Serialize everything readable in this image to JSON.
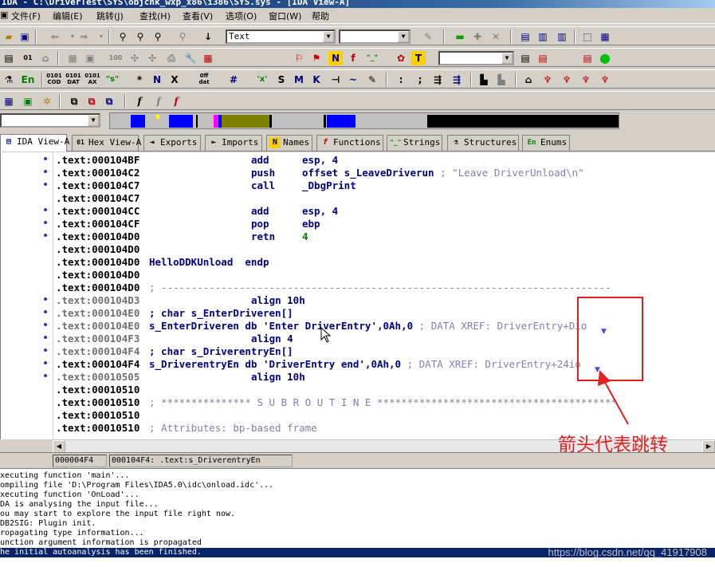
{
  "window": {
    "title": "IDA - C:\\DriverTest\\SYS\\objchk_wxp_x86\\i386\\SYS.sys - [IDA View-A]"
  },
  "menu": {
    "items": [
      "文件(F)",
      "编辑(E)",
      "跳转(J)",
      "查找(H)",
      "查看(V)",
      "选项(O)",
      "窗口(W)",
      "帮助"
    ]
  },
  "toolbar": {
    "text_combo_value": "Text",
    "row3_labels": {
      "en": "En",
      "cod": "0101\nCOD",
      "dat": "0101\nDAT",
      "ax": "0101\nAX",
      "s": "\"s\"",
      "star": "*",
      "n": "N",
      "x": "X",
      "off": "0ff\ndat",
      "hash": "#",
      "x2": "'x'",
      "S": "S",
      "M": "M",
      "K": "K",
      "colon": ":",
      "semicolon": ";"
    }
  },
  "tabs": [
    {
      "label": "IDA View-A",
      "icon": "ida-view-icon"
    },
    {
      "label": "Hex View-A",
      "icon": "hex-view-icon"
    },
    {
      "label": "Exports",
      "icon": "exports-icon"
    },
    {
      "label": "Imports",
      "icon": "imports-icon"
    },
    {
      "label": "Names",
      "icon": "names-icon"
    },
    {
      "label": "Functions",
      "icon": "functions-icon"
    },
    {
      "label": "Strings",
      "icon": "strings-icon"
    },
    {
      "label": "Structures",
      "icon": "structures-icon"
    },
    {
      "label": "Enums",
      "icon": "enums-icon"
    }
  ],
  "disasm": {
    "lines": [
      {
        "addr": ".text:000104BF",
        "label": "",
        "mnem": "add",
        "ops": "esp, 4",
        "cmt": ""
      },
      {
        "addr": ".text:000104C2",
        "label": "",
        "mnem": "push",
        "ops": "offset s_LeaveDriverun",
        "cmt": " ; \"Leave DriverUnload\\n\""
      },
      {
        "addr": ".text:000104C7",
        "label": "",
        "mnem": "call",
        "ops": "_DbgPrint",
        "cmt": ""
      },
      {
        "addr": ".text:000104C7",
        "label": "",
        "mnem": "",
        "ops": "",
        "cmt": ""
      },
      {
        "addr": ".text:000104CC",
        "label": "",
        "mnem": "add",
        "ops": "esp, 4",
        "cmt": ""
      },
      {
        "addr": ".text:000104CF",
        "label": "",
        "mnem": "pop",
        "ops": "ebp",
        "cmt": ""
      },
      {
        "addr": ".text:000104D0",
        "label": "",
        "mnem": "retn",
        "ops": "4",
        "cmt": ""
      },
      {
        "addr": ".text:000104D0",
        "label": "",
        "mnem": "",
        "ops": "",
        "cmt": ""
      },
      {
        "addr": ".text:000104D0",
        "label": "HelloDDKUnload  endp",
        "mnem": "",
        "ops": "",
        "cmt": ""
      },
      {
        "addr": ".text:000104D0",
        "label": "",
        "mnem": "",
        "ops": "",
        "cmt": ""
      },
      {
        "addr": ".text:000104D0",
        "label": "",
        "mnem": "",
        "ops": "",
        "cmt": "; ---------------------------------------------------------------------------"
      },
      {
        "addr": ".text:000104D3",
        "label": "",
        "mnem": "align 10h",
        "ops": "",
        "cmt": ""
      },
      {
        "addr": ".text:000104E0",
        "label": "; char s_EnterDriveren[]",
        "mnem": "",
        "ops": "",
        "cmt": ""
      },
      {
        "addr": ".text:000104E0",
        "label": "s_EnterDriveren db 'Enter DriverEntry',0Ah,0",
        "mnem": "",
        "ops": "",
        "cmt": " ; DATA XREF: DriverEntry+Dio"
      },
      {
        "addr": ".text:000104F3",
        "label": "",
        "mnem": "align 4",
        "ops": "",
        "cmt": ""
      },
      {
        "addr": ".text:000104F4",
        "label": "; char s_DriverentryEn[]",
        "mnem": "",
        "ops": "",
        "cmt": ""
      },
      {
        "addr": ".text:000104F4",
        "label": "s_DriverentryEn db 'DriverEntry end',0Ah,0",
        "mnem": "",
        "ops": "",
        "cmt": " ; DATA XREF: DriverEntry+24io"
      },
      {
        "addr": ".text:00010505",
        "label": "",
        "mnem": "align 10h",
        "ops": "",
        "cmt": ""
      },
      {
        "addr": ".text:00010510",
        "label": "",
        "mnem": "",
        "ops": "",
        "cmt": ""
      },
      {
        "addr": ".text:00010510",
        "label": "",
        "mnem": "",
        "ops": "",
        "cmt": "; *************** S U B R O U T I N E ****************************************"
      },
      {
        "addr": ".text:00010510",
        "label": "",
        "mnem": "",
        "ops": "",
        "cmt": ""
      },
      {
        "addr": ".text:00010510",
        "label": "",
        "mnem": "",
        "ops": "",
        "cmt": "; Attributes: bp-based frame"
      }
    ]
  },
  "status": {
    "offset": "000004F4",
    "location": "000104F4: .text:s_DriverentryEn"
  },
  "output": {
    "lines": [
      "xecuting function 'main'...",
      "ompiling file 'D:\\Program Files\\IDA5.0\\idc\\onload.idc'...",
      "xecuting function 'OnLoad'...",
      "DA is analysing the input file...",
      "ou may start to explore the input file right now.",
      "DB2SIG: Plugin init.",
      "ropagating type information...",
      "unction argument information is propagated",
      "he initial autoanalysis has been finished."
    ],
    "watermark": "https://blog.csdn.net/qq_41917908"
  },
  "annotation": {
    "text": "箭头代表跳转",
    "color": "#e02020"
  }
}
